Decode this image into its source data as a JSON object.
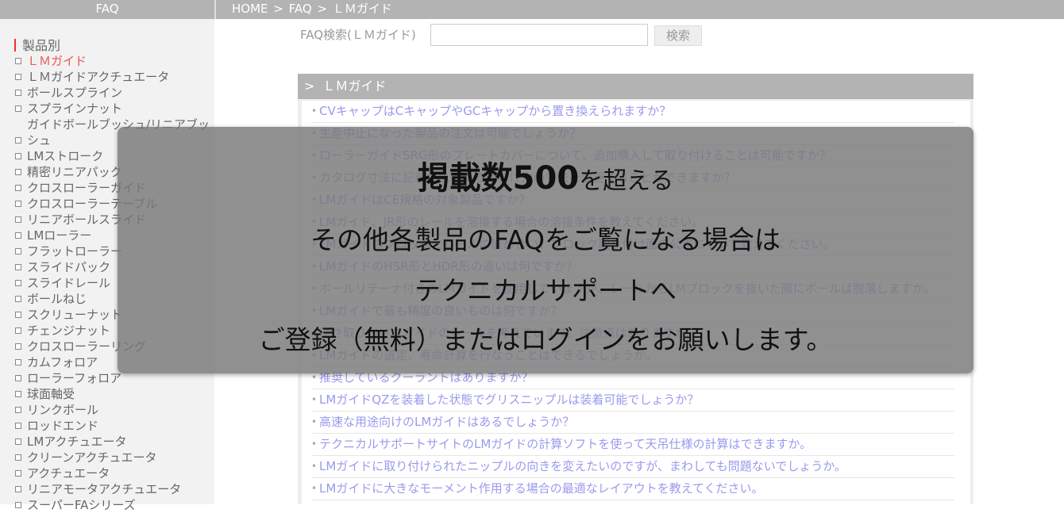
{
  "topbar": {
    "left_title": "FAQ",
    "breadcrumb": [
      "HOME",
      ">",
      "FAQ",
      ">",
      "ＬＭガイド"
    ]
  },
  "sidebar": {
    "heading": "製品別",
    "items": [
      {
        "label": "ＬＭガイド",
        "active": true
      },
      {
        "label": "ＬＭガイドアクチュエータ"
      },
      {
        "label": "ボールスプライン"
      },
      {
        "label": "スプラインナット"
      },
      {
        "label": "ガイドボールブッシュ/リニアブッシュ"
      },
      {
        "label": "LMストローク"
      },
      {
        "label": "精密リニアパック"
      },
      {
        "label": "クロスローラーガイド"
      },
      {
        "label": "クロスローラーテーブル"
      },
      {
        "label": "リニアボールスライド"
      },
      {
        "label": "LMローラー"
      },
      {
        "label": "フラットローラー"
      },
      {
        "label": "スライドパック"
      },
      {
        "label": "スライドレール"
      },
      {
        "label": "ボールねじ"
      },
      {
        "label": "スクリューナット"
      },
      {
        "label": "チェンジナット"
      },
      {
        "label": "クロスローラーリング"
      },
      {
        "label": "カムフォロア"
      },
      {
        "label": "ローラーフォロア"
      },
      {
        "label": "球面軸受"
      },
      {
        "label": "リンクボール"
      },
      {
        "label": "ロッドエンド"
      },
      {
        "label": "LMアクチュエータ"
      },
      {
        "label": "クリーンアクチュエータ"
      },
      {
        "label": "アクチュエータ"
      },
      {
        "label": "リニアモータアクチュエータ"
      },
      {
        "label": "スーパーFAシリーズ"
      }
    ]
  },
  "search": {
    "label": "FAQ検索(ＬＭガイド)",
    "value": "",
    "button": "検索"
  },
  "panel": {
    "title": "ＬＭガイド",
    "questions": [
      "CVキャップはCキャップやGCキャップから置き換えられますか？",
      "生産中止になった製品の注文は可能でしょうか？",
      "ローラーガイドSRG形のプレートカバーについて、追加購入して取り付けることは可能ですか？",
      "カタログ寸法に記載されている取付け穴の寸法を変更することができますか？",
      "LMガイドはCE規格の対象製品ですか？",
      "LMガイド、JR形のレールを溶接する場合の溶接条件を教えてください。",
      "LMガイドのブロックとレールの嵌め合い、ブロック取り付け面の公差について教えてください。",
      "LMガイドのHSR形とHDR形の違いは何ですか？",
      "ボールリテーナ付きのLMガイドを使用していますが、レールからLMブロックを抜いた際にボールは脱落しますか。",
      "LMガイドで最も精度の良いものは何ですか？",
      "逆さ取り付けでガイドのレールを考えています。注意点はありますか。",
      "LMガイドの選定、寿命計算を行なうことはできるでしょうか。",
      "推奨しているクーラントはありますか？",
      "LMガイドQZを装着した状態でグリスニップルは装着可能でしょうか？",
      "高速な用途向けのLMガイドはあるでしょうか？",
      "テクニカルサポートサイトのLMガイドの計算ソフトを使って天吊仕様の計算はできますか。",
      "LMガイドに取り付けられたニップルの向きを変えたいのですが、まわしても問題ないでしょうか。",
      "LMガイドに大きなモーメント作用する場合の最適なレイアウトを教えてください。"
    ]
  },
  "overlay": {
    "line1_bold": "掲載数500",
    "line1_rest": "を超える",
    "line2": "その他各製品のFAQをご覧になる場合は",
    "line3": "テクニカルサポートへ",
    "line4": "ご登録（無料）またはログインをお願いします。"
  }
}
